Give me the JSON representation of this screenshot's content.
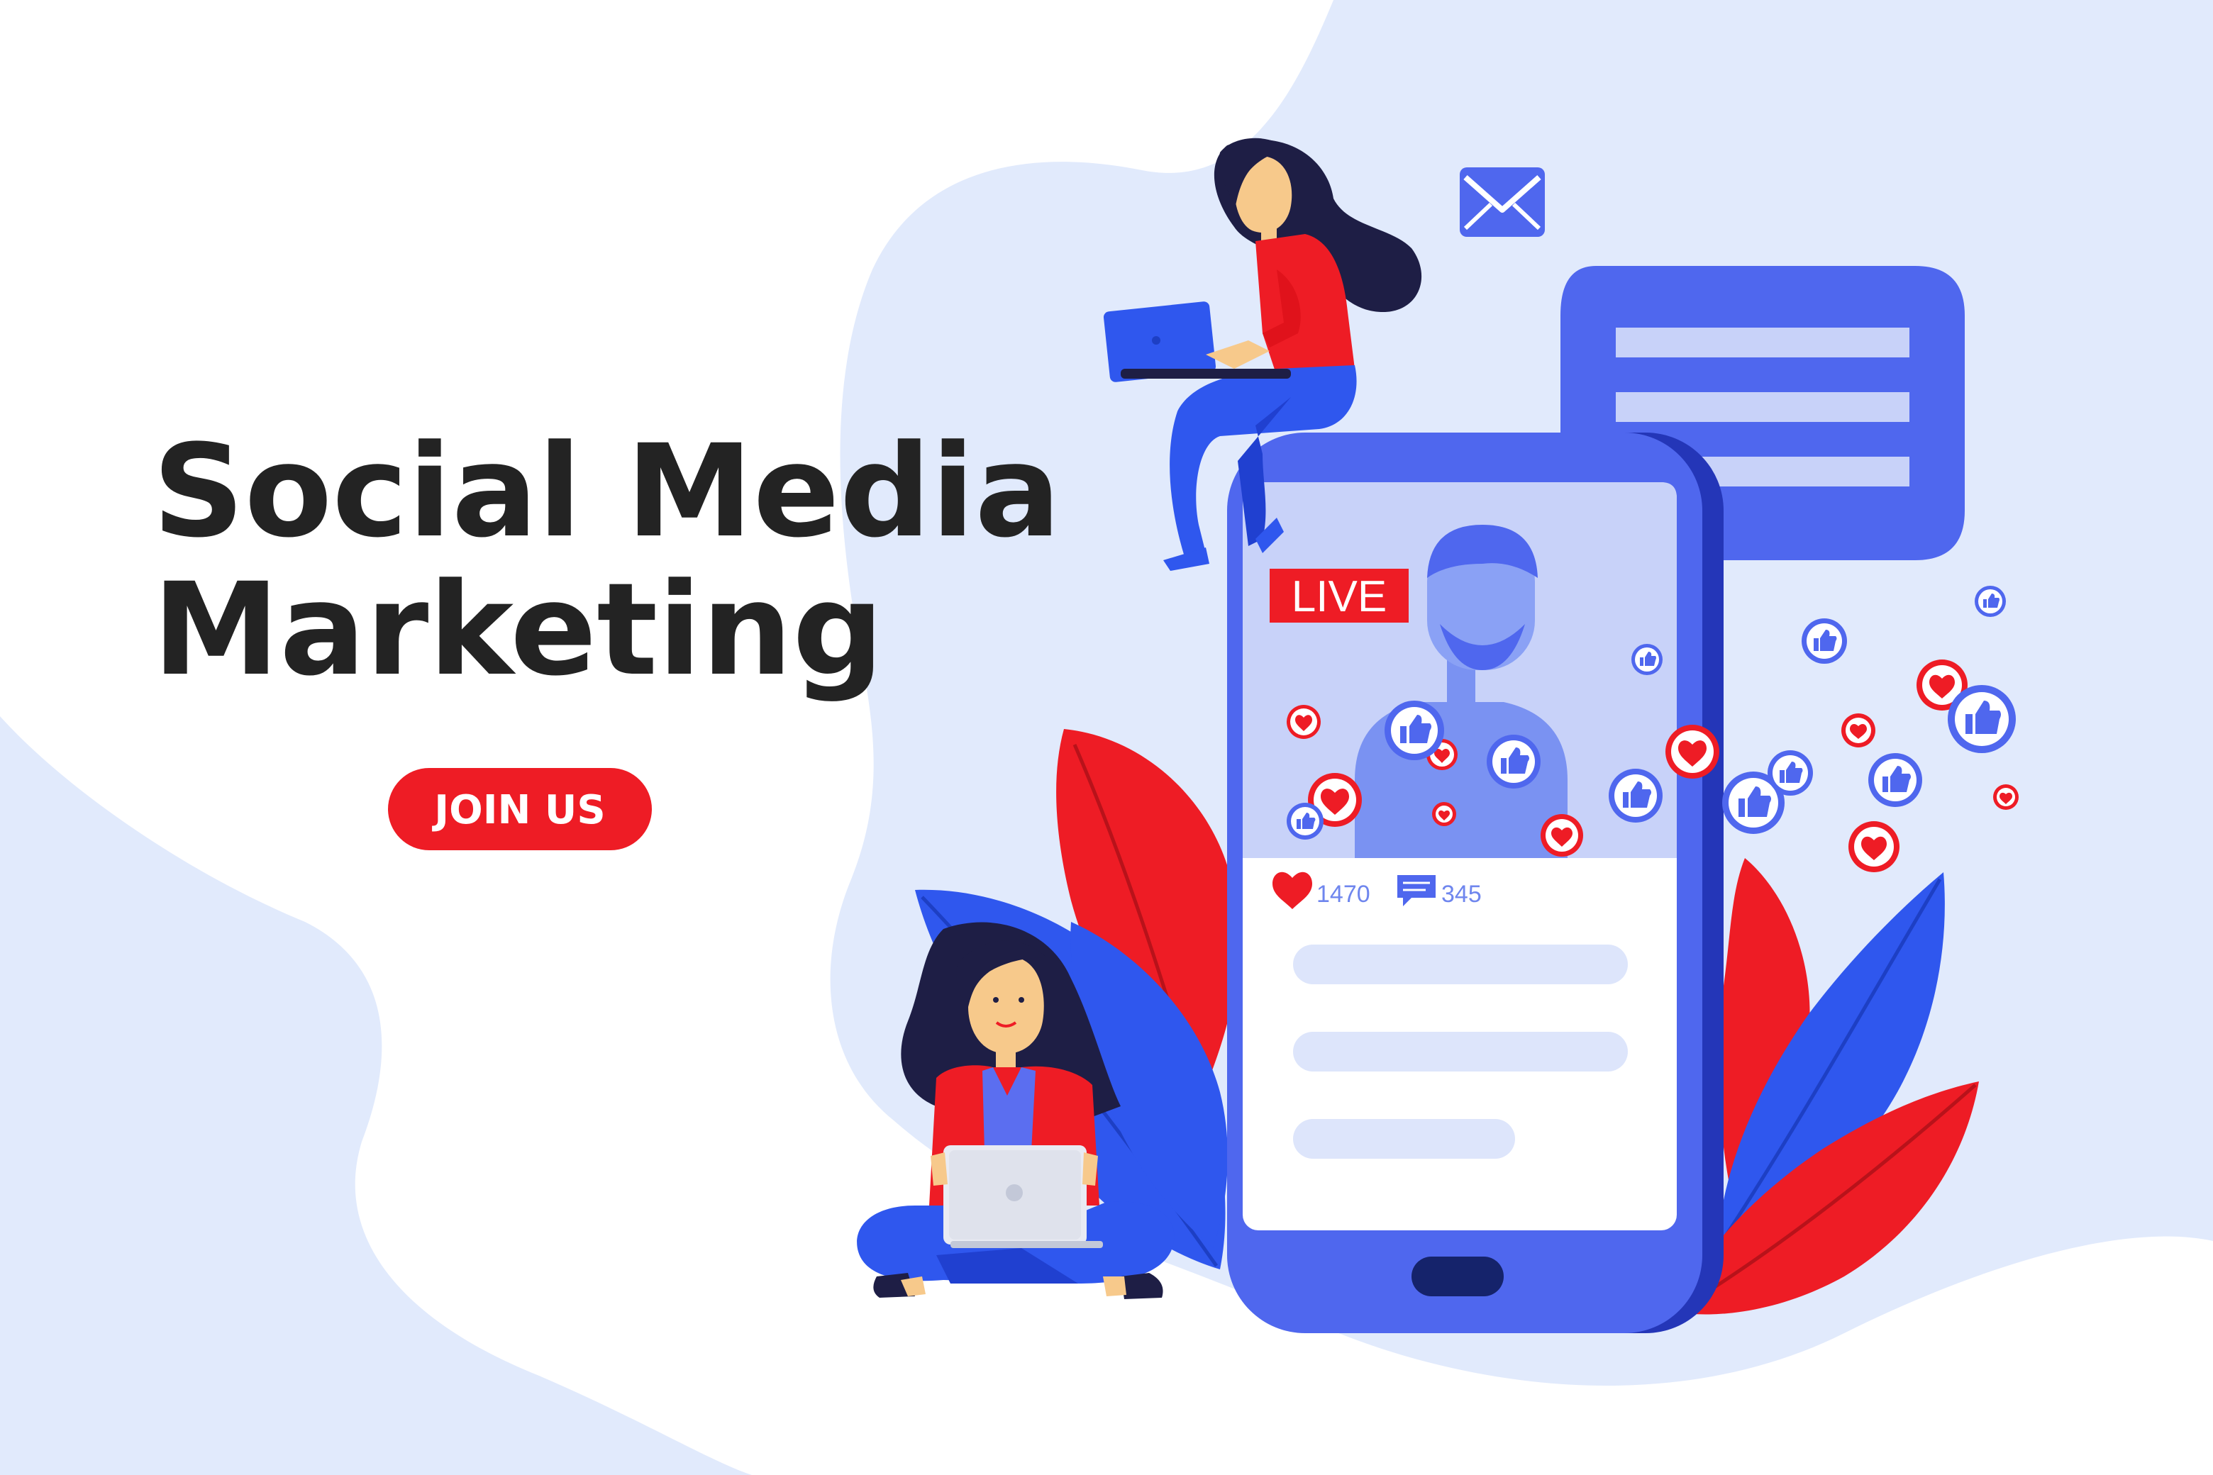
{
  "headline": {
    "line1": "Social Media",
    "line2": "Marketing"
  },
  "cta": {
    "label": "JOIN US"
  },
  "phone": {
    "live_label": "LIVE",
    "likes": "1470",
    "comments": "345"
  },
  "icons": {
    "envelope": "envelope-icon",
    "chat": "chat-bubble-icon",
    "heart": "heart-icon",
    "thumbs_up": "thumbs-up-icon",
    "comment": "comment-icon"
  },
  "colors": {
    "text": "#232323",
    "accent_red": "#ee1c25",
    "brand_blue": "#4f67ee",
    "light_blue": "#e1eafc",
    "screen_blue": "#c8d2f9"
  }
}
